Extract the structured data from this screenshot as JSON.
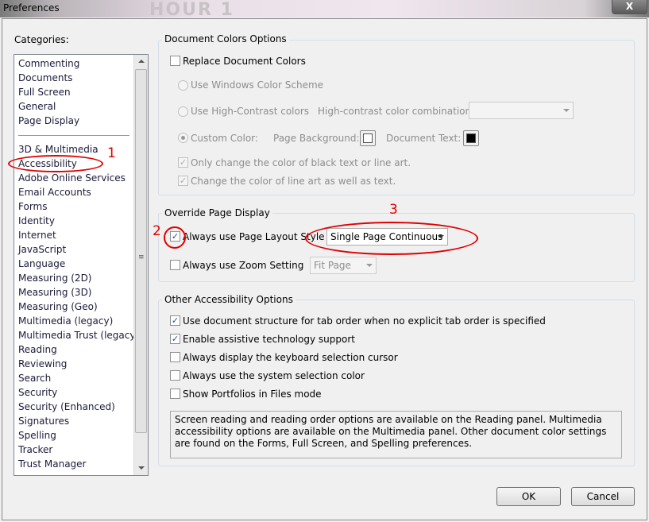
{
  "window": {
    "title": "Preferences",
    "background_text": "HOUR 1",
    "close_label": "X"
  },
  "categories": {
    "label": "Categories:",
    "group1": [
      "Commenting",
      "Documents",
      "Full Screen",
      "General",
      "Page Display"
    ],
    "group2": [
      "3D & Multimedia",
      "Accessibility",
      "Adobe Online Services",
      "Email Accounts",
      "Forms",
      "Identity",
      "Internet",
      "JavaScript",
      "Language",
      "Measuring (2D)",
      "Measuring (3D)",
      "Measuring (Geo)",
      "Multimedia (legacy)",
      "Multimedia Trust (legacy)",
      "Reading",
      "Reviewing",
      "Search",
      "Security",
      "Security (Enhanced)",
      "Signatures",
      "Spelling",
      "Tracker",
      "Trust Manager"
    ],
    "selected": "Accessibility"
  },
  "doc_colors": {
    "title": "Document Colors Options",
    "replace": "Replace Document Colors",
    "windows_scheme": "Use Windows Color Scheme",
    "high_contrast": "Use High-Contrast colors",
    "hc_combo_label": "High-contrast color combination:",
    "hc_combo_value": "",
    "custom": "Custom Color:",
    "page_bg": "Page Background:",
    "doc_text": "Document Text:",
    "page_bg_color": "#ffffff",
    "doc_text_color": "#000000",
    "only_black": "Only change the color of black text or line art.",
    "line_art": "Change the color of line art as well as text."
  },
  "override": {
    "title": "Override Page Display",
    "layout_label": "Always use Page Layout Style",
    "layout_value": "Single Page Continuous",
    "zoom_label": "Always use Zoom Setting",
    "zoom_value": "Fit Page"
  },
  "other": {
    "title": "Other Accessibility Options",
    "items": [
      {
        "label": "Use document structure for tab order when no explicit tab order is specified",
        "checked": true
      },
      {
        "label": "Enable assistive technology support",
        "checked": true
      },
      {
        "label": "Always display the keyboard selection cursor",
        "checked": false
      },
      {
        "label": "Always use the system selection color",
        "checked": false
      },
      {
        "label": "Show Portfolios in Files mode",
        "checked": false
      }
    ],
    "info": "Screen reading and reading order options are available on the Reading panel. Multimedia accessibility options are available on the Multimedia panel. Other document color settings are found on the Forms, Full Screen, and Spelling preferences."
  },
  "buttons": {
    "ok": "OK",
    "cancel": "Cancel"
  },
  "annotations": {
    "one": "1",
    "two": "2",
    "three": "3",
    "color": "#e00000"
  }
}
